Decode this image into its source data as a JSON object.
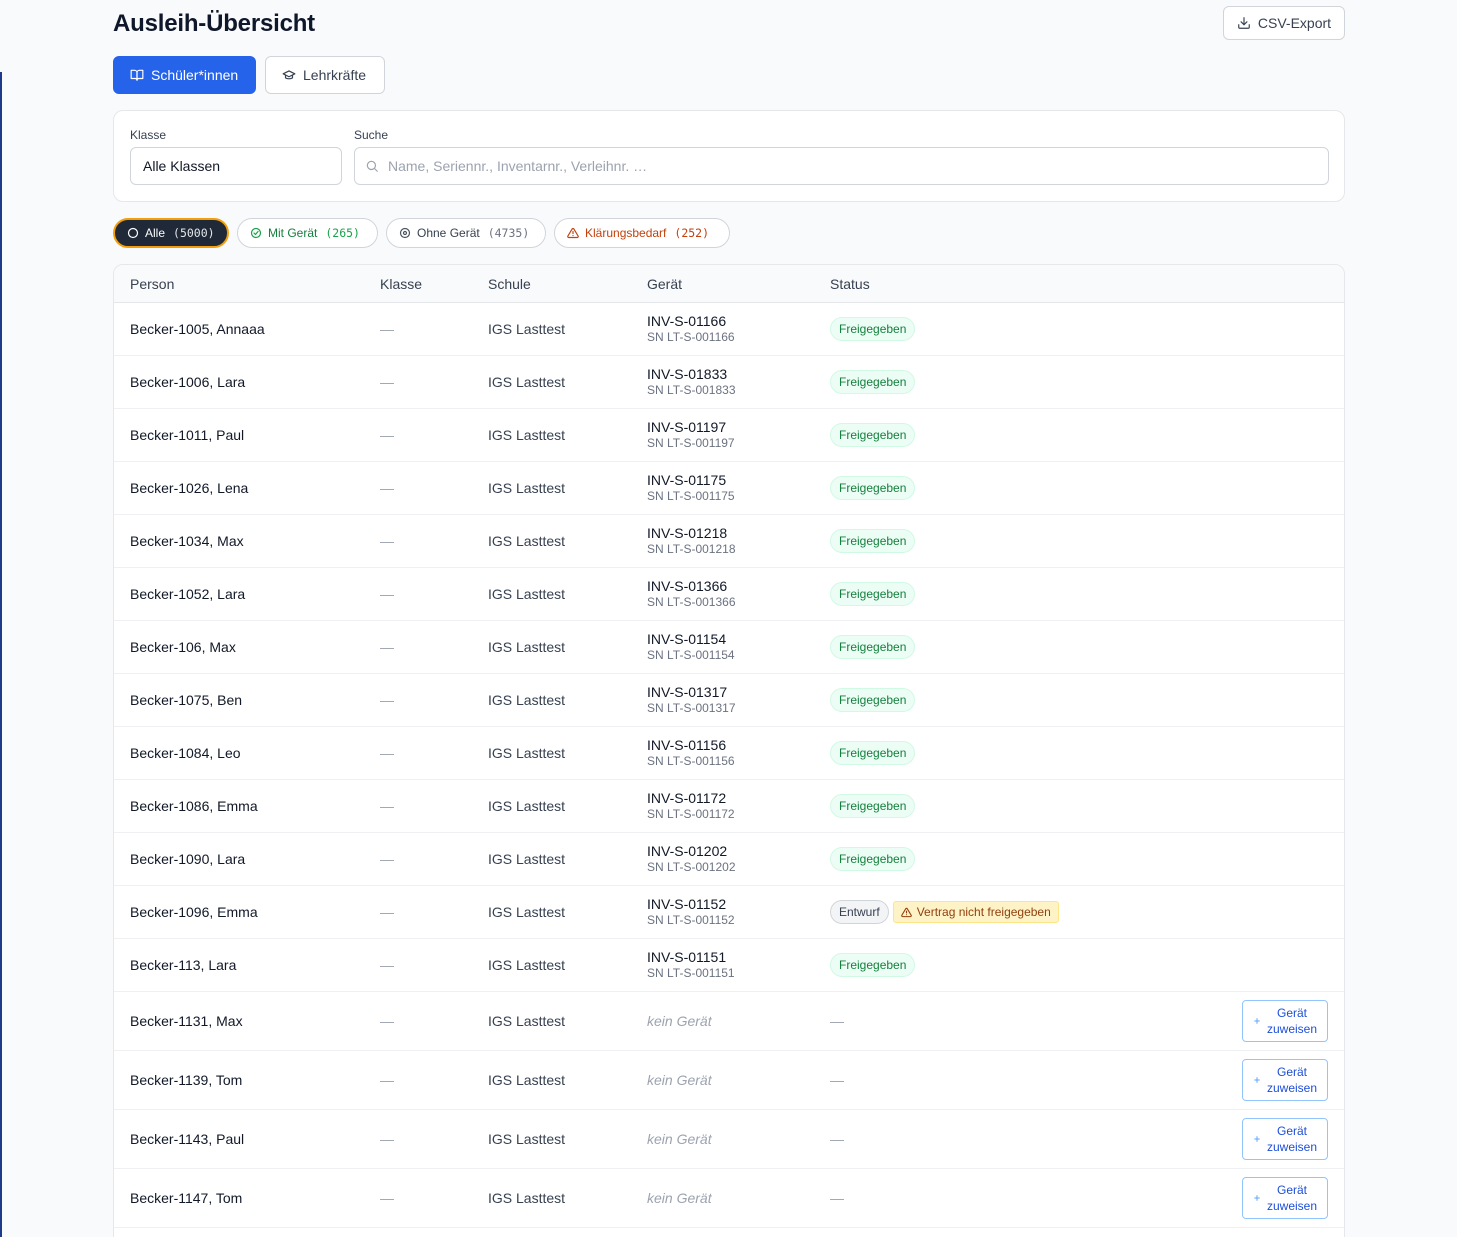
{
  "header": {
    "title": "Ausleih-Übersicht",
    "csv_label": "CSV-Export"
  },
  "tabs": [
    {
      "label": "Schüler*innen",
      "icon": "book-icon",
      "active": true
    },
    {
      "label": "Lehrkräfte",
      "icon": "graduation-cap-icon",
      "active": false
    }
  ],
  "filters": {
    "class_label": "Klasse",
    "class_value": "Alle Klassen",
    "search_label": "Suche",
    "search_placeholder": "Name, Seriennr., Inventarnr., Verleihnr. …"
  },
  "chips": [
    {
      "label": "Alle",
      "count": "(5000)",
      "icon": "circle-icon"
    },
    {
      "label": "Mit Gerät",
      "count": "(265)",
      "icon": "check-circle-icon"
    },
    {
      "label": "Ohne Gerät",
      "count": "(4735)",
      "icon": "help-circle-icon"
    },
    {
      "label": "Klärungsbedarf",
      "count": "(252)",
      "icon": "warning-triangle-icon"
    }
  ],
  "table": {
    "headers": {
      "person": "Person",
      "klasse": "Klasse",
      "schule": "Schule",
      "geraet": "Gerät",
      "status": "Status"
    },
    "rows": [
      {
        "person": "Becker-1005, Annaaa",
        "klasse": "—",
        "schule": "IGS Lasttest",
        "inv": "INV-S-01166",
        "sn": "SN LT-S-001166",
        "status": "Freigegeben"
      },
      {
        "person": "Becker-1006, Lara",
        "klasse": "—",
        "schule": "IGS Lasttest",
        "inv": "INV-S-01833",
        "sn": "SN LT-S-001833",
        "status": "Freigegeben"
      },
      {
        "person": "Becker-1011, Paul",
        "klasse": "—",
        "schule": "IGS Lasttest",
        "inv": "INV-S-01197",
        "sn": "SN LT-S-001197",
        "status": "Freigegeben"
      },
      {
        "person": "Becker-1026, Lena",
        "klasse": "—",
        "schule": "IGS Lasttest",
        "inv": "INV-S-01175",
        "sn": "SN LT-S-001175",
        "status": "Freigegeben"
      },
      {
        "person": "Becker-1034, Max",
        "klasse": "—",
        "schule": "IGS Lasttest",
        "inv": "INV-S-01218",
        "sn": "SN LT-S-001218",
        "status": "Freigegeben"
      },
      {
        "person": "Becker-1052, Lara",
        "klasse": "—",
        "schule": "IGS Lasttest",
        "inv": "INV-S-01366",
        "sn": "SN LT-S-001366",
        "status": "Freigegeben"
      },
      {
        "person": "Becker-106, Max",
        "klasse": "—",
        "schule": "IGS Lasttest",
        "inv": "INV-S-01154",
        "sn": "SN LT-S-001154",
        "status": "Freigegeben"
      },
      {
        "person": "Becker-1075, Ben",
        "klasse": "—",
        "schule": "IGS Lasttest",
        "inv": "INV-S-01317",
        "sn": "SN LT-S-001317",
        "status": "Freigegeben"
      },
      {
        "person": "Becker-1084, Leo",
        "klasse": "—",
        "schule": "IGS Lasttest",
        "inv": "INV-S-01156",
        "sn": "SN LT-S-001156",
        "status": "Freigegeben"
      },
      {
        "person": "Becker-1086, Emma",
        "klasse": "—",
        "schule": "IGS Lasttest",
        "inv": "INV-S-01172",
        "sn": "SN LT-S-001172",
        "status": "Freigegeben"
      },
      {
        "person": "Becker-1090, Lara",
        "klasse": "—",
        "schule": "IGS Lasttest",
        "inv": "INV-S-01202",
        "sn": "SN LT-S-001202",
        "status": "Freigegeben"
      },
      {
        "person": "Becker-1096, Emma",
        "klasse": "—",
        "schule": "IGS Lasttest",
        "inv": "INV-S-01152",
        "sn": "SN LT-S-001152",
        "status": "Entwurf",
        "warning": "Vertrag nicht freigegeben"
      },
      {
        "person": "Becker-113, Lara",
        "klasse": "—",
        "schule": "IGS Lasttest",
        "inv": "INV-S-01151",
        "sn": "SN LT-S-001151",
        "status": "Freigegeben"
      },
      {
        "person": "Becker-1131, Max",
        "klasse": "—",
        "schule": "IGS Lasttest",
        "no_device": "kein Gerät",
        "status_dash": "—",
        "assign_line1": "Gerät",
        "assign_line2": "zuweisen"
      },
      {
        "person": "Becker-1139, Tom",
        "klasse": "—",
        "schule": "IGS Lasttest",
        "no_device": "kein Gerät",
        "status_dash": "—",
        "assign_line1": "Gerät",
        "assign_line2": "zuweisen"
      },
      {
        "person": "Becker-1143, Paul",
        "klasse": "—",
        "schule": "IGS Lasttest",
        "no_device": "kein Gerät",
        "status_dash": "—",
        "assign_line1": "Gerät",
        "assign_line2": "zuweisen"
      },
      {
        "person": "Becker-1147, Tom",
        "klasse": "—",
        "schule": "IGS Lasttest",
        "no_device": "kein Gerät",
        "status_dash": "—",
        "assign_line1": "Gerät",
        "assign_line2": "zuweisen"
      }
    ]
  },
  "colors": {
    "primary": "#2563eb",
    "success": "#15803d",
    "warning": "#c2410c",
    "dark_chip": "#1f2937",
    "chip_outline": "#f59e0b"
  }
}
